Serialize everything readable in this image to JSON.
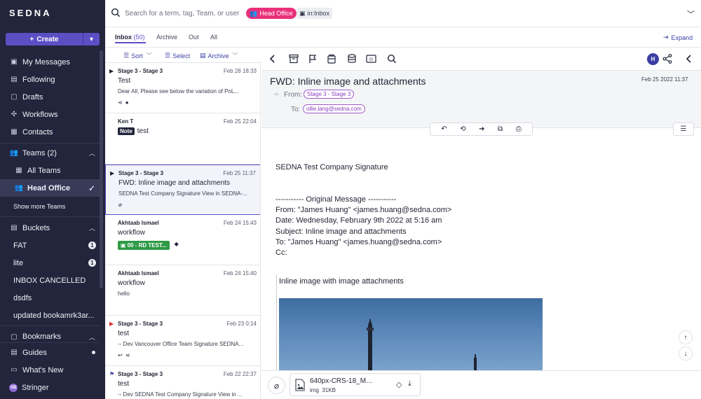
{
  "app": {
    "logo": "SEDNA"
  },
  "sidebar": {
    "create_label": "Create",
    "items": [
      {
        "label": "My Messages",
        "icon": "inbox-stack-icon"
      },
      {
        "label": "Following",
        "icon": "bookmark-icon"
      },
      {
        "label": "Drafts",
        "icon": "draft-icon"
      },
      {
        "label": "Workflows",
        "icon": "workflow-icon"
      },
      {
        "label": "Contacts",
        "icon": "contacts-icon"
      }
    ],
    "teams": {
      "label": "Teams (2)",
      "all_teams": "All Teams",
      "head_office": "Head Office",
      "show_more": "Show more Teams"
    },
    "buckets": {
      "label": "Buckets",
      "items": [
        {
          "label": "FAT",
          "count": "1"
        },
        {
          "label": "lite",
          "count": "1"
        },
        {
          "label": "INBOX CANCELLED",
          "count": ""
        },
        {
          "label": "dsdfs",
          "count": ""
        },
        {
          "label": "updated bookamrk3ar...",
          "count": ""
        }
      ]
    },
    "bookmarks_label": "Bookmarks",
    "guides_label": "Guides",
    "whats_new_label": "What's New",
    "user": {
      "initials": "SB",
      "name": "Stringer"
    }
  },
  "search": {
    "placeholder": "Search for a term, tag, Team, or user",
    "chips": {
      "team": "Head Office",
      "folder": "in:Inbox"
    }
  },
  "tabs": [
    {
      "label": "Inbox",
      "count": "(50)"
    },
    {
      "label": "Archive"
    },
    {
      "label": "Out"
    },
    {
      "label": "All"
    }
  ],
  "expand_label": "Expand",
  "list_toolbar": {
    "sort": "Sort",
    "select": "Select",
    "archive": "Archive"
  },
  "messages": [
    {
      "sender": "Stage 3 - Stage 3",
      "date": "Feb 28 18:33",
      "subject": "Test",
      "preview": "Dear All, Please see below the variation of PnL..."
    },
    {
      "sender": "Ken T",
      "date": "Feb 25 22:04",
      "note": "Note",
      "subject": "test"
    },
    {
      "sender": "Stage 3 - Stage 3",
      "date": "Feb 25 11:37",
      "subject": "FWD: Inline image and attachments",
      "preview": "SEDNA Test Company Signature View in SEDNA-..."
    },
    {
      "sender": "Akhtaab Ismael",
      "date": "Feb 24 15:43",
      "subject": "workflow",
      "tag": "00 - RD TEST..."
    },
    {
      "sender": "Akhtaab Ismael",
      "date": "Feb 24 15:40",
      "subject": "workflow",
      "preview": "hello"
    },
    {
      "sender": "Stage 3 - Stage 3",
      "date": "Feb 23 0:14",
      "subject": "test",
      "preview": "-- Dev Vancouver Office Team Signature SEDNA..."
    },
    {
      "sender": "Stage 3 - Stage 3",
      "date": "Feb 22 22:37",
      "subject": "test",
      "preview": "-- Dev SEDNA Test Company Signature View in ..."
    }
  ],
  "reader": {
    "avatar": "H",
    "subject": "FWD: Inline image and attachments",
    "date": "Feb 25 2022 11:37",
    "from_label": "From:",
    "from": "Stage 3 - Stage 3",
    "to_label": "To:",
    "to": "ollie.lang@sedna.com",
    "body": {
      "signature": "SEDNA Test Company Signature",
      "original": "----------- Original Message -----------",
      "from": "From: \"James Huang\" <james.huang@sedna.com>",
      "date": "Date: Wednesday, February 9th 2022 at 5:16 am",
      "subject": "Subject: Inline image and attachments",
      "to": "To: \"James Huang\" <james.huang@sedna.com>",
      "cc": "Cc:",
      "quote": "Inline image with image attachments"
    },
    "attachment": {
      "name": "640px-CRS-18_Mission_...",
      "type": "img",
      "size": "31KB"
    }
  }
}
